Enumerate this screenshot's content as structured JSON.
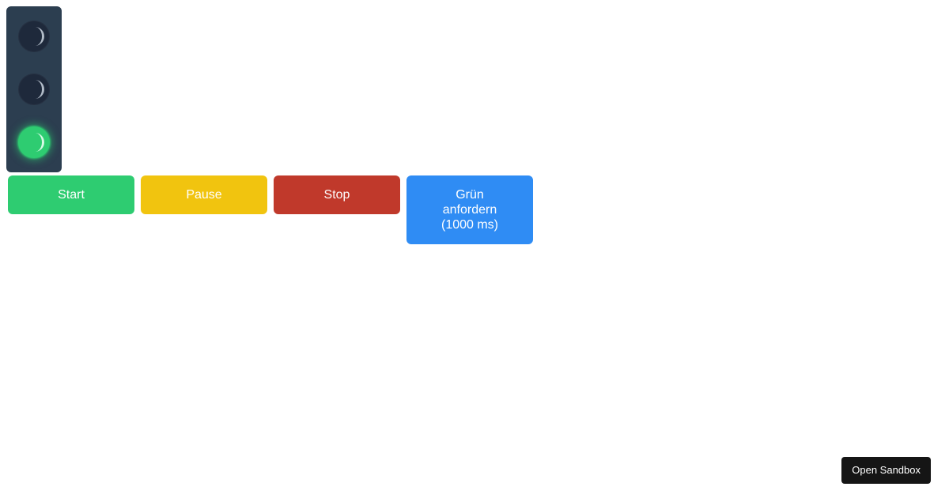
{
  "traffic_light": {
    "active_lamp": "green",
    "lamps": [
      "red",
      "yellow",
      "green"
    ]
  },
  "buttons": {
    "start": {
      "label": "Start",
      "color": "#2ecc71"
    },
    "pause": {
      "label": "Pause",
      "color": "#f1c40f"
    },
    "stop": {
      "label": "Stop",
      "color": "#c0392b"
    },
    "request_green": {
      "label": "Grün anfordern (1000 ms)",
      "color": "#2f8cf4"
    }
  },
  "sandbox": {
    "label": "Open Sandbox"
  },
  "icons": {
    "lamp_glyph": "crescent-moon-icon"
  },
  "colors": {
    "housing": "#2c3e50",
    "lamp_off": "#1e293b",
    "lamp_on_green": "#2ecc71",
    "sandbox_bg": "#151515"
  }
}
